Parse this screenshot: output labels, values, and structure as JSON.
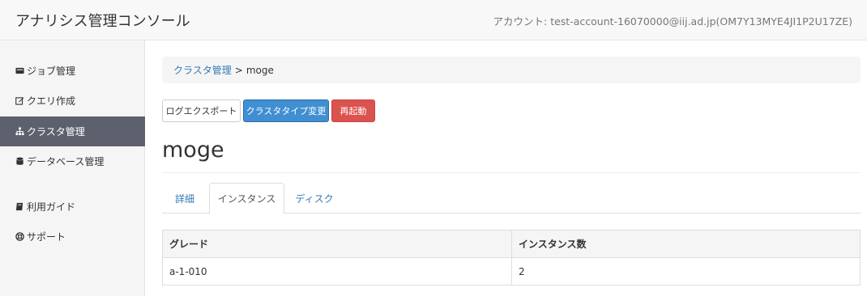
{
  "header": {
    "app_title": "アナリシス管理コンソール",
    "account": "アカウント: test-account-16070000@iij.ad.jp(OM7Y13MYE4JI1P2U17ZE)"
  },
  "sidebar": {
    "items": [
      {
        "label": "ジョブ管理",
        "icon": "job-icon",
        "active": false
      },
      {
        "label": "クエリ作成",
        "icon": "edit-icon",
        "active": false
      },
      {
        "label": "クラスタ管理",
        "icon": "sitemap-icon",
        "active": true
      },
      {
        "label": "データベース管理",
        "icon": "database-icon",
        "active": false
      },
      {
        "label": "利用ガイド",
        "icon": "book-icon",
        "active": false
      },
      {
        "label": "サポート",
        "icon": "lifebuoy-icon",
        "active": false
      }
    ]
  },
  "breadcrumb": {
    "parent": "クラスタ管理",
    "separator": ">",
    "current": "moge"
  },
  "toolbar": {
    "export_label": "ログエクスポート",
    "change_type_label": "クラスタタイプ変更",
    "restart_label": "再起動"
  },
  "page": {
    "title": "moge"
  },
  "tabs": [
    {
      "label": "詳細",
      "active": false
    },
    {
      "label": "インスタンス",
      "active": true
    },
    {
      "label": "ディスク",
      "active": false
    }
  ],
  "table": {
    "headers": [
      "グレード",
      "インスタンス数"
    ],
    "rows": [
      [
        "a-1-010",
        "2"
      ]
    ]
  },
  "colors": {
    "primary": "#3f8fd2",
    "danger": "#d9534f",
    "sidebar_active": "#5d616e",
    "link": "#337ab7"
  }
}
